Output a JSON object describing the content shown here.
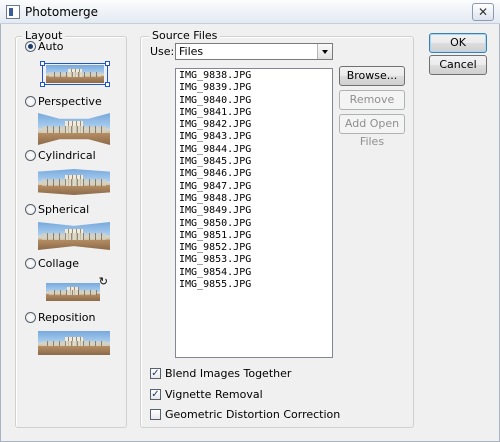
{
  "window": {
    "title": "Photomerge",
    "close_glyph": "✕"
  },
  "layout": {
    "legend": "Layout",
    "options": [
      {
        "label": "Auto",
        "checked": true
      },
      {
        "label": "Perspective",
        "checked": false
      },
      {
        "label": "Cylindrical",
        "checked": false
      },
      {
        "label": "Spherical",
        "checked": false
      },
      {
        "label": "Collage",
        "checked": false
      },
      {
        "label": "Reposition",
        "checked": false
      }
    ]
  },
  "source": {
    "legend": "Source Files",
    "use_label": "Use:",
    "use_value": "Files",
    "files": [
      "IMG_9838.JPG",
      "IMG_9839.JPG",
      "IMG_9840.JPG",
      "IMG_9841.JPG",
      "IMG_9842.JPG",
      "IMG_9843.JPG",
      "IMG_9844.JPG",
      "IMG_9845.JPG",
      "IMG_9846.JPG",
      "IMG_9847.JPG",
      "IMG_9848.JPG",
      "IMG_9849.JPG",
      "IMG_9850.JPG",
      "IMG_9851.JPG",
      "IMG_9852.JPG",
      "IMG_9853.JPG",
      "IMG_9854.JPG",
      "IMG_9855.JPG"
    ],
    "browse_label": "Browse...",
    "remove_label": "Remove",
    "add_open_label": "Add Open Files"
  },
  "options": {
    "blend_label": "Blend Images Together",
    "blend_checked": true,
    "vignette_label": "Vignette Removal",
    "vignette_checked": true,
    "geometric_label": "Geometric Distortion Correction",
    "geometric_checked": false
  },
  "dialog": {
    "ok_label": "OK",
    "cancel_label": "Cancel"
  },
  "icons": {
    "checkmark": "✓",
    "collage_rotate": "↻"
  }
}
